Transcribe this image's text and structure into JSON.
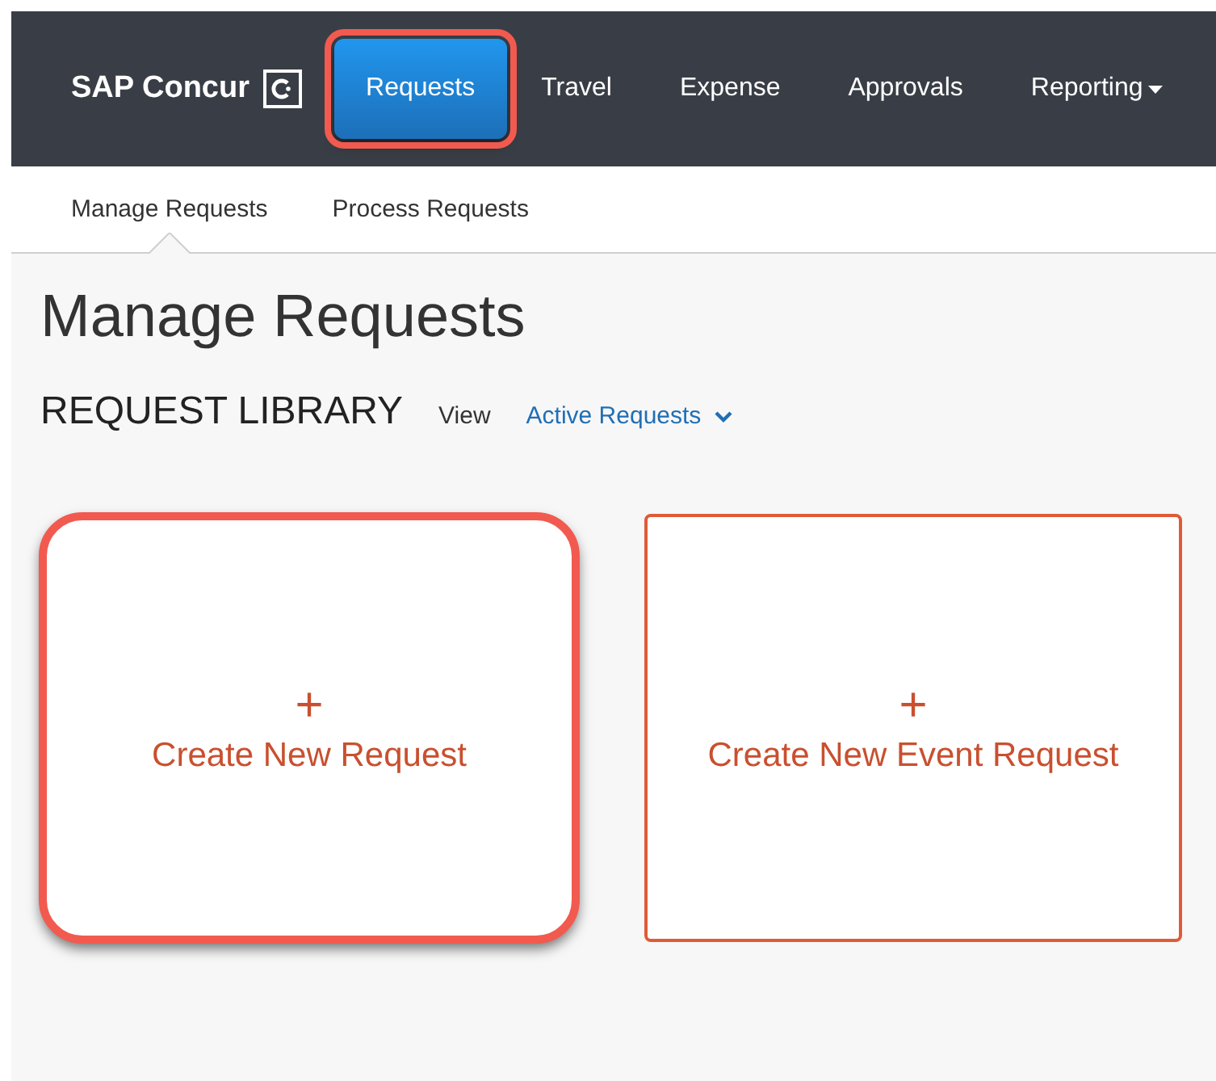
{
  "brand": {
    "name": "SAP Concur"
  },
  "nav": [
    {
      "label": "Requests",
      "selected": true,
      "highlighted": true,
      "dropdown": false
    },
    {
      "label": "Travel",
      "selected": false,
      "highlighted": false,
      "dropdown": false
    },
    {
      "label": "Expense",
      "selected": false,
      "highlighted": false,
      "dropdown": false
    },
    {
      "label": "Approvals",
      "selected": false,
      "highlighted": false,
      "dropdown": false
    },
    {
      "label": "Reporting",
      "selected": false,
      "highlighted": false,
      "dropdown": true
    }
  ],
  "subnav": [
    {
      "label": "Manage Requests",
      "selected": true
    },
    {
      "label": "Process Requests",
      "selected": false
    }
  ],
  "page_title": "Manage Requests",
  "library": {
    "title": "REQUEST LIBRARY",
    "view_label": "View",
    "view_value": "Active Requests"
  },
  "cards": [
    {
      "icon": "+",
      "label": "Create New Request",
      "highlighted": true
    },
    {
      "icon": "+",
      "label": "Create New Event Request",
      "highlighted": false
    }
  ]
}
